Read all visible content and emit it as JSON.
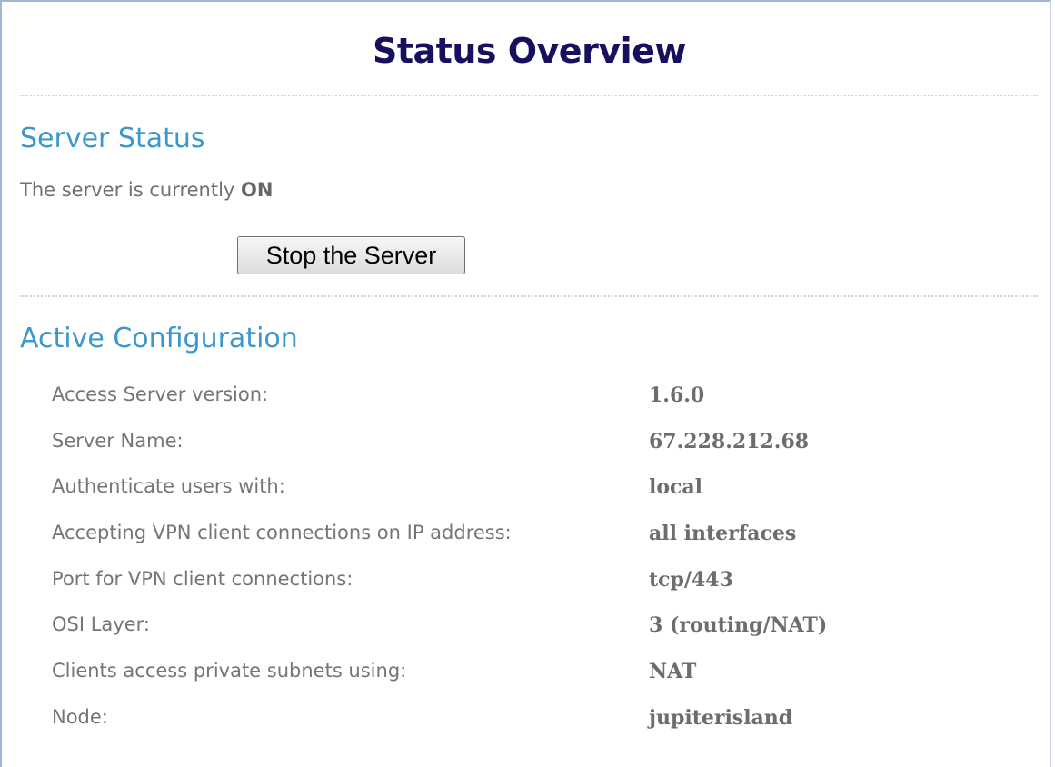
{
  "page": {
    "title": "Status Overview"
  },
  "server_status": {
    "heading": "Server Status",
    "status_prefix": "The server is currently ",
    "status_value": "ON",
    "stop_button_label": "Stop the Server"
  },
  "active_configuration": {
    "heading": "Active Configuration",
    "rows": [
      {
        "label": "Access Server version:",
        "value": "1.6.0"
      },
      {
        "label": "Server Name:",
        "value": "67.228.212.68"
      },
      {
        "label": "Authenticate users with:",
        "value": "local"
      },
      {
        "label": "Accepting VPN client connections on IP address:",
        "value": "all interfaces"
      },
      {
        "label": "Port for VPN client connections:",
        "value": "tcp/443"
      },
      {
        "label": "OSI Layer:",
        "value": "3 (routing/NAT)"
      },
      {
        "label": "Clients access private subnets using:",
        "value": "NAT"
      },
      {
        "label": "Node:",
        "value": "jupiterisland"
      }
    ]
  },
  "colors": {
    "title": "#16105e",
    "section_heading": "#3b98cc",
    "label_text": "#757575",
    "value_text": "#6d6d6d",
    "frame_border": "#9fb4d6"
  }
}
